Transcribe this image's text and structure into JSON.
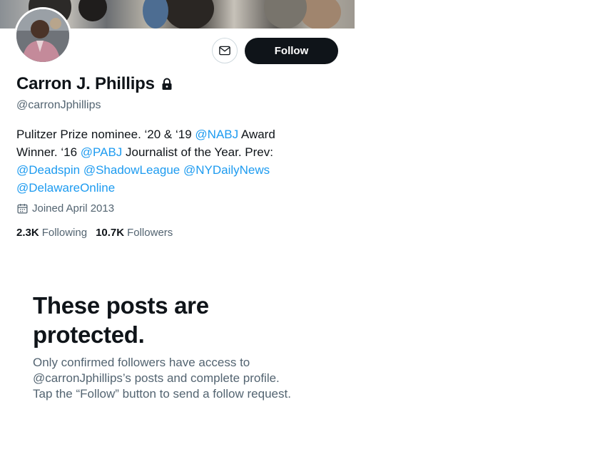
{
  "profile": {
    "name": "Carron J. Phillips",
    "handle": "@carronJphillips",
    "lock_icon": "lock-icon",
    "bio": {
      "line1_text": "Pulitzer Prize nominee. ‘20 & ‘19 ",
      "line1_mention": "@NABJ",
      "line1_after": " Award",
      "line2_text": "Winner. ‘16 ",
      "line2_mention": "@PABJ",
      "line2_after": " Journalist of the Year. Prev:",
      "line3_mentions": [
        "@Deadspin",
        "@ShadowLeague",
        "@NYDailyNews"
      ],
      "line4_mention": "@DelawareOnline"
    },
    "joined": "Joined April 2013",
    "following_count": "2.3K",
    "following_label": "Following",
    "followers_count": "10.7K",
    "followers_label": "Followers"
  },
  "actions": {
    "message_icon": "envelope-icon",
    "follow_label": "Follow"
  },
  "protected": {
    "title": "These posts are protected.",
    "body_line1": "Only confirmed followers have access to",
    "body_line2": "@carronJphillips’s posts and complete profile.",
    "body_line3": "Tap the “Follow” button to send a follow request."
  },
  "colors": {
    "accent": "#1d9bf0",
    "text": "#0f1419",
    "secondary": "#536471",
    "button_bg": "#0f1419"
  }
}
